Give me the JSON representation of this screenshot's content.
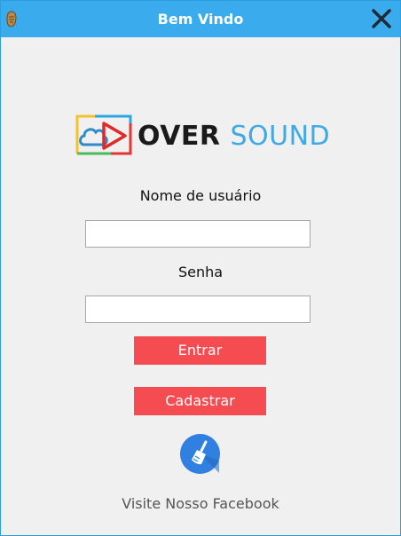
{
  "window": {
    "title": "Bem Vindo"
  },
  "logo": {
    "word1": "OVER",
    "word2": "SOUND"
  },
  "form": {
    "username_label": "Nome de usuário",
    "username_value": "",
    "password_label": "Senha",
    "password_value": ""
  },
  "buttons": {
    "login": "Entrar",
    "register": "Cadastrar",
    "clear_icon": "broom-icon"
  },
  "footer": {
    "facebook_link": "Visite Nosso Facebook"
  },
  "colors": {
    "titlebar": "#3aacee",
    "button": "#f44c50",
    "logo_accent": "#3fa9e6",
    "clear_button": "#2f80e0"
  }
}
